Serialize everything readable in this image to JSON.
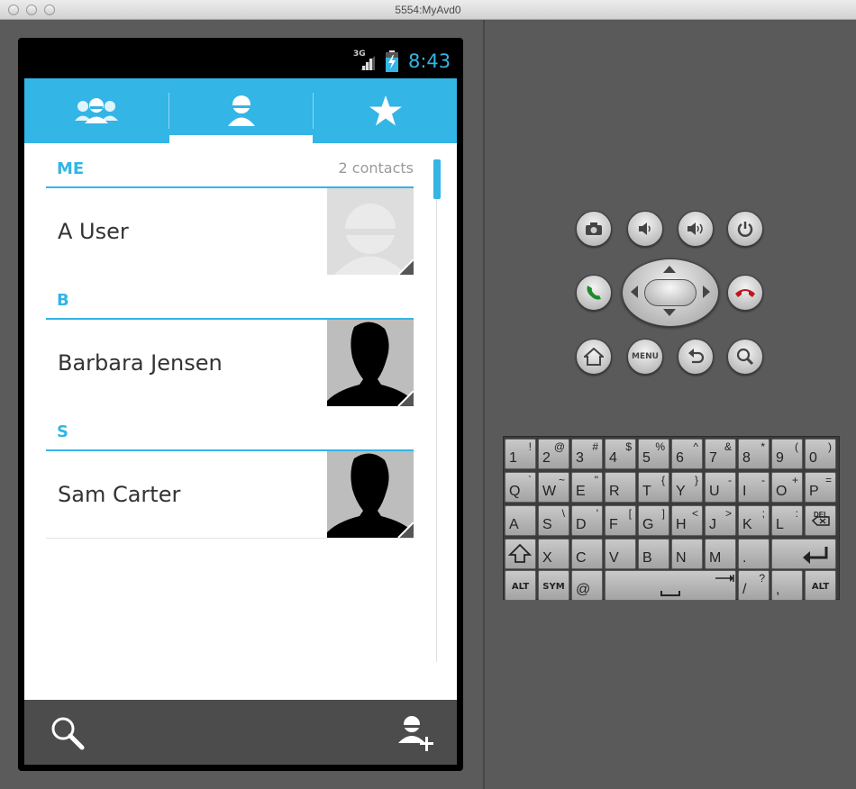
{
  "window": {
    "title": "5554:MyAvd0"
  },
  "status_bar": {
    "network": "3G",
    "time": "8:43",
    "accent": "#33b5e5"
  },
  "tabs": [
    {
      "name": "groups",
      "icon": "groups-icon",
      "selected": false
    },
    {
      "name": "all-contacts",
      "icon": "person-icon",
      "selected": true
    },
    {
      "name": "favorites",
      "icon": "star-icon",
      "selected": false
    }
  ],
  "contacts": {
    "me_header": "ME",
    "count_label": "2 contacts",
    "sections": [
      {
        "letter": "B",
        "name": "Barbara Jensen"
      },
      {
        "letter": "S",
        "name": "Sam Carter"
      }
    ],
    "me_name": "A User"
  },
  "bottom_bar": {
    "left_icon": "search-icon",
    "right_icon": "add-contact-icon"
  },
  "hardware_buttons": [
    "camera-icon",
    "volume-down-icon",
    "volume-up-icon",
    "power-icon",
    "call-icon",
    "end-call-icon",
    "home-icon",
    "menu",
    "back-icon",
    "search-icon"
  ],
  "hw_menu_label": "MENU",
  "keyboard": {
    "row1": [
      [
        "1",
        "!"
      ],
      [
        "2",
        "@"
      ],
      [
        "3",
        "#"
      ],
      [
        "4",
        "$"
      ],
      [
        "5",
        "%"
      ],
      [
        "6",
        "^"
      ],
      [
        "7",
        "&"
      ],
      [
        "8",
        "*"
      ],
      [
        "9",
        "("
      ],
      [
        "0",
        ")"
      ]
    ],
    "row2": [
      [
        "Q",
        "`"
      ],
      [
        "W",
        "~"
      ],
      [
        "E",
        "\""
      ],
      [
        "R",
        ""
      ],
      [
        "T",
        "{"
      ],
      [
        "Y",
        "}"
      ],
      [
        "U",
        "-"
      ],
      [
        "I",
        "-"
      ],
      [
        "O",
        "+"
      ],
      [
        "P",
        "="
      ]
    ],
    "row3": [
      [
        "A",
        ""
      ],
      [
        "S",
        "\\"
      ],
      [
        "D",
        "'"
      ],
      [
        "F",
        "["
      ],
      [
        "G",
        "]"
      ],
      [
        "H",
        "<"
      ],
      [
        "J",
        ">"
      ],
      [
        "K",
        ";"
      ],
      [
        "L",
        ":"
      ]
    ],
    "row4": [
      [
        "X",
        ""
      ],
      [
        "C",
        ""
      ],
      [
        "V",
        ""
      ],
      [
        "B",
        ""
      ],
      [
        "N",
        ""
      ],
      [
        "M",
        ""
      ],
      [
        ".",
        ""
      ]
    ],
    "del_label": "DEL",
    "alt_label": "ALT",
    "sym_label": "SYM",
    "at_label": "@",
    "slash_label": "/",
    "question_label": "?",
    "comma_label": ","
  }
}
